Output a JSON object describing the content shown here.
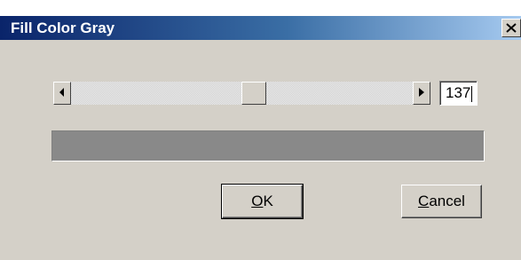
{
  "window": {
    "title": "Fill Color Gray"
  },
  "slider": {
    "value": "137",
    "min": 0,
    "max": 255,
    "fraction": 0.537
  },
  "preview": {
    "color": "#898989"
  },
  "buttons": {
    "ok_accel": "O",
    "ok_rest": "K",
    "cancel_accel": "C",
    "cancel_rest": "ancel"
  },
  "icons": {
    "close": "close-icon",
    "left_arrow": "arrow-left-icon",
    "right_arrow": "arrow-right-icon"
  }
}
